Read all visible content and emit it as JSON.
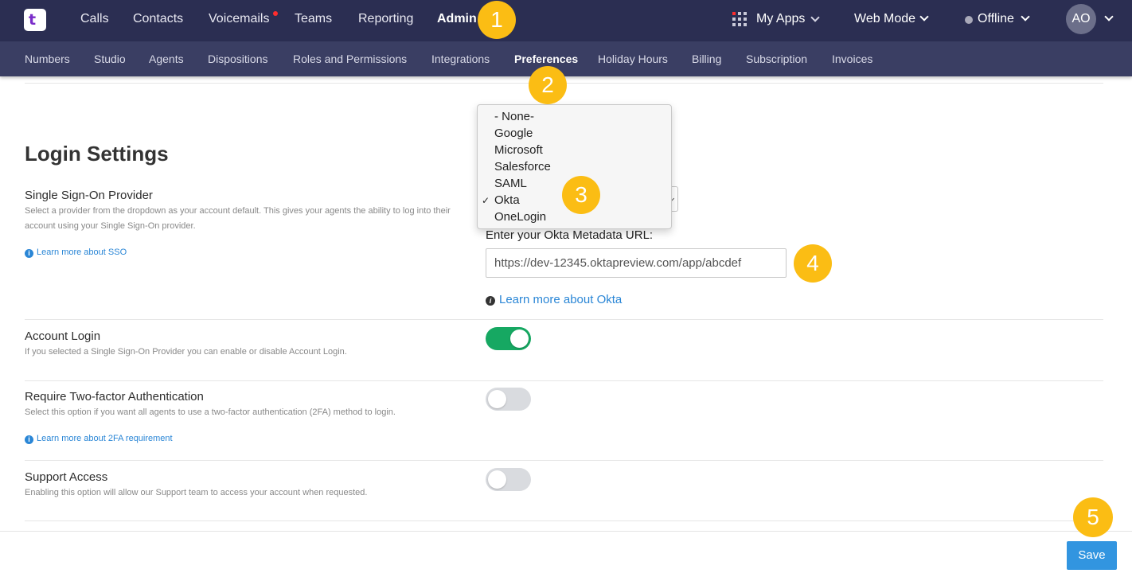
{
  "topnav": {
    "logo": "t",
    "items": [
      "Calls",
      "Contacts",
      "Voicemails",
      "Teams",
      "Reporting",
      "Admin"
    ],
    "my_apps": "My Apps",
    "web_mode": "Web Mode",
    "status": "Offline",
    "avatar_initials": "AO"
  },
  "subnav": {
    "items": [
      "Numbers",
      "Studio",
      "Agents",
      "Dispositions",
      "Roles and Permissions",
      "Integrations",
      "Preferences",
      "Holiday Hours",
      "Billing",
      "Subscription",
      "Invoices"
    ]
  },
  "login_settings": {
    "title": "Login Settings",
    "sso": {
      "title": "Single Sign-On Provider",
      "desc": "Select a provider from the dropdown as your account default. This gives your agents the ability to log into their account using your Single Sign-On provider.",
      "link": "Learn more about SSO",
      "options": [
        "- None-",
        "Google",
        "Microsoft",
        "Salesforce",
        "SAML",
        "Okta",
        "OneLogin"
      ],
      "selected": "Okta",
      "check_mark": "✓"
    },
    "okta": {
      "label": "Enter your Okta Metadata URL:",
      "value": "https://dev-12345.oktapreview.com/app/abcdef",
      "link": "Learn more about Okta"
    },
    "account_login": {
      "title": "Account Login",
      "desc": "If you selected a Single Sign-On Provider you can enable or disable Account Login.",
      "enabled": true
    },
    "two_factor": {
      "title": "Require Two-factor Authentication",
      "desc": "Select this option if you want all agents to use a two-factor authentication (2FA) method to login.",
      "link": "Learn more about 2FA requirement",
      "enabled": false
    },
    "support_access": {
      "title": "Support Access",
      "desc": "Enabling this option will allow our Support team to access your account when requested.",
      "enabled": false
    }
  },
  "save_label": "Save",
  "step_markers": [
    "1",
    "2",
    "3",
    "4",
    "5"
  ],
  "colors": {
    "topbar": "#2b2e52",
    "subbar": "#3a3e63",
    "accent_blue": "#3295e0",
    "toggle_on": "#16a862",
    "marker": "#fbbd14"
  }
}
